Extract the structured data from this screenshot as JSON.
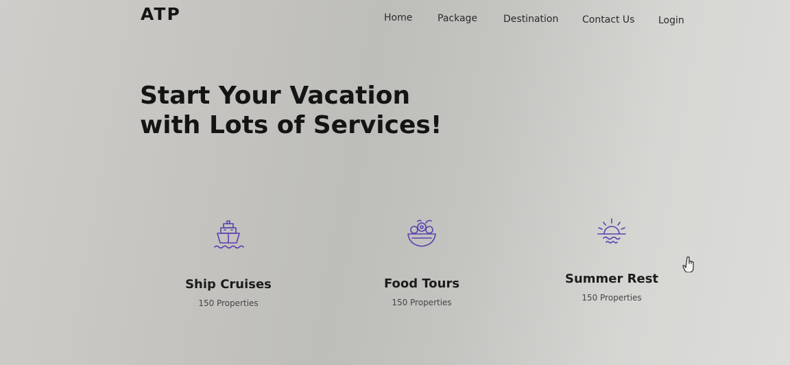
{
  "header": {
    "logo": "ATP",
    "nav": [
      {
        "label": "Home"
      },
      {
        "label": "Package"
      },
      {
        "label": "Destination"
      },
      {
        "label": "Contact Us"
      },
      {
        "label": "Login"
      }
    ]
  },
  "hero": {
    "title": "Start Your Vacation with Lots of Services!"
  },
  "services": [
    {
      "icon": "ship-icon",
      "name": "Ship Cruises",
      "meta": "150 Properties"
    },
    {
      "icon": "food-bowl-icon",
      "name": "Food Tours",
      "meta": "150 Properties"
    },
    {
      "icon": "sunset-icon",
      "name": "Summer Rest",
      "meta": "150 Properties"
    }
  ],
  "colors": {
    "accent": "#5a3fb0",
    "text": "#151515",
    "background": "#c8c7c3"
  }
}
